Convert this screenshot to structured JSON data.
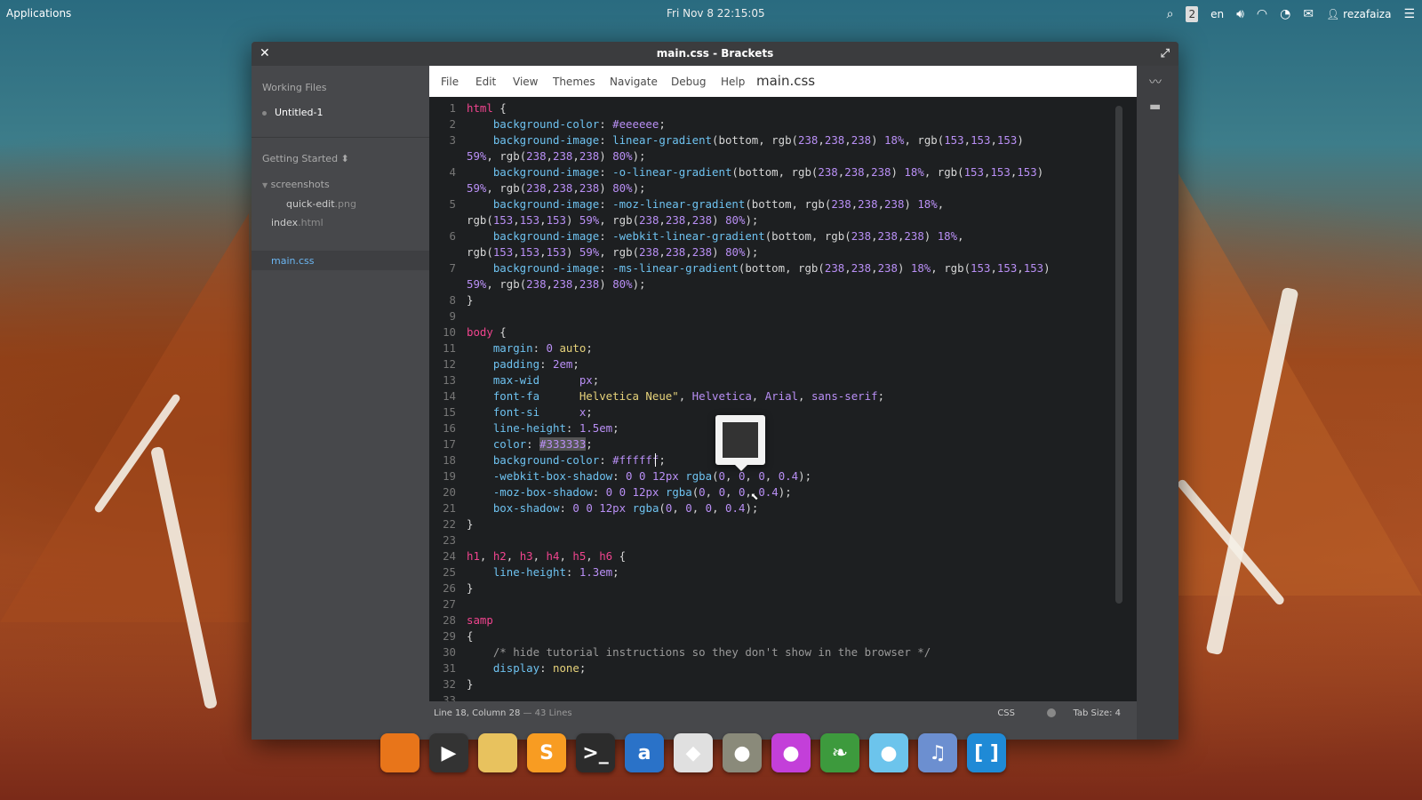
{
  "top_panel": {
    "applications": "Applications",
    "clock": "Fri Nov  8 22:15:05",
    "indicators": [
      "search-icon",
      "workspace-icon",
      "en",
      "volume-icon",
      "wifi-icon",
      "power-icon",
      "mail-icon",
      "user-icon"
    ],
    "language": "en",
    "workspace": "2",
    "user": "rezafaiza"
  },
  "window": {
    "title": "main.css - Brackets"
  },
  "sidebar": {
    "working_files_heading": "Working Files",
    "working_files": [
      "Untitled-1"
    ],
    "project_heading": "Getting Started ⬍",
    "folder": "screenshots",
    "folder_file_name": "quick-edit",
    "folder_file_ext": ".png",
    "file_index_name": "index",
    "file_index_ext": ".html",
    "file_main": "main.css"
  },
  "menu": {
    "items": [
      "File",
      "Edit",
      "View",
      "Themes",
      "Navigate",
      "Debug",
      "Help"
    ],
    "current_file": "main.css"
  },
  "editor": {
    "line_numbers": [
      "1",
      "2",
      "3",
      "",
      "4",
      "",
      "5",
      "",
      "6",
      "",
      "7",
      "",
      "8",
      "9",
      "10",
      "11",
      "12",
      "13",
      "14",
      "15",
      "16",
      "17",
      "18",
      "19",
      "20",
      "21",
      "22",
      "23",
      "24",
      "25",
      "26",
      "27",
      "28",
      "29",
      "30",
      "31",
      "32",
      "33"
    ],
    "color_preview": "#333333"
  },
  "status": {
    "position": "Line 18, Column 28",
    "lines": " — 43 Lines",
    "language": "CSS",
    "tab_size": "Tab Size: 4"
  },
  "dock": [
    {
      "name": "firefox-icon",
      "glyph": "",
      "color": "#e8751a"
    },
    {
      "name": "video-camera-icon",
      "glyph": "▶",
      "color": "#333"
    },
    {
      "name": "files-folder-icon",
      "glyph": "",
      "color": "#e8c25e"
    },
    {
      "name": "sublime-text-icon",
      "glyph": "S",
      "color": "#f89c22"
    },
    {
      "name": "terminal-icon",
      "glyph": ">_",
      "color": "#2c2c2c"
    },
    {
      "name": "app-store-icon",
      "glyph": "a",
      "color": "#2a72c8"
    },
    {
      "name": "inkscape-icon",
      "glyph": "◆",
      "color": "#e0e0e0"
    },
    {
      "name": "gimp-icon",
      "glyph": "●",
      "color": "#8a8a7a"
    },
    {
      "name": "chat-icon",
      "glyph": "●",
      "color": "#c33fd9"
    },
    {
      "name": "leaf-icon",
      "glyph": "❧",
      "color": "#3d9a3d"
    },
    {
      "name": "twitter-bird-icon",
      "glyph": "●",
      "color": "#6cc4ec"
    },
    {
      "name": "music-icon",
      "glyph": "♫",
      "color": "#6c8fd0"
    },
    {
      "name": "brackets-icon",
      "glyph": "[ ]",
      "color": "#1f8ad6"
    }
  ]
}
